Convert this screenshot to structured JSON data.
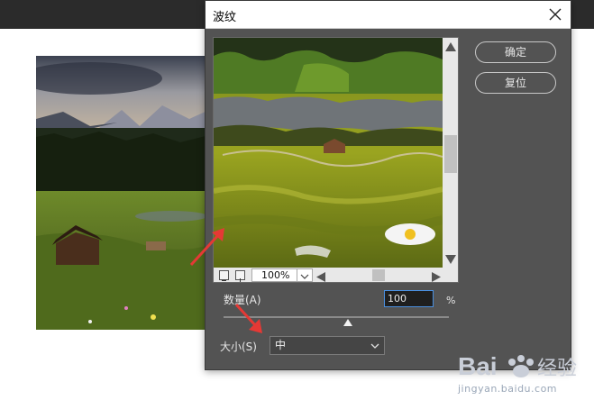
{
  "dialog": {
    "title": "波纹",
    "ok_label": "确定",
    "reset_label": "复位"
  },
  "preview": {
    "zoom_value": "100%"
  },
  "amount": {
    "label": "数量(A)",
    "value": "100",
    "unit": "%",
    "slider_fraction": 0.55
  },
  "size": {
    "label": "大小(S)",
    "selected": "中"
  },
  "watermark": {
    "url": "jingyan.baidu.com"
  },
  "colors": {
    "accent_arrow": "#e53935",
    "dialog_bg": "#535353",
    "focus_border": "#4a8fe0"
  },
  "icons": [
    "close-icon",
    "zoom-out-icon",
    "zoom-in-icon",
    "chevron-down-icon",
    "arrow-up-icon",
    "arrow-down-icon",
    "arrow-left-icon",
    "arrow-right-icon",
    "baidu-paw-logo"
  ]
}
